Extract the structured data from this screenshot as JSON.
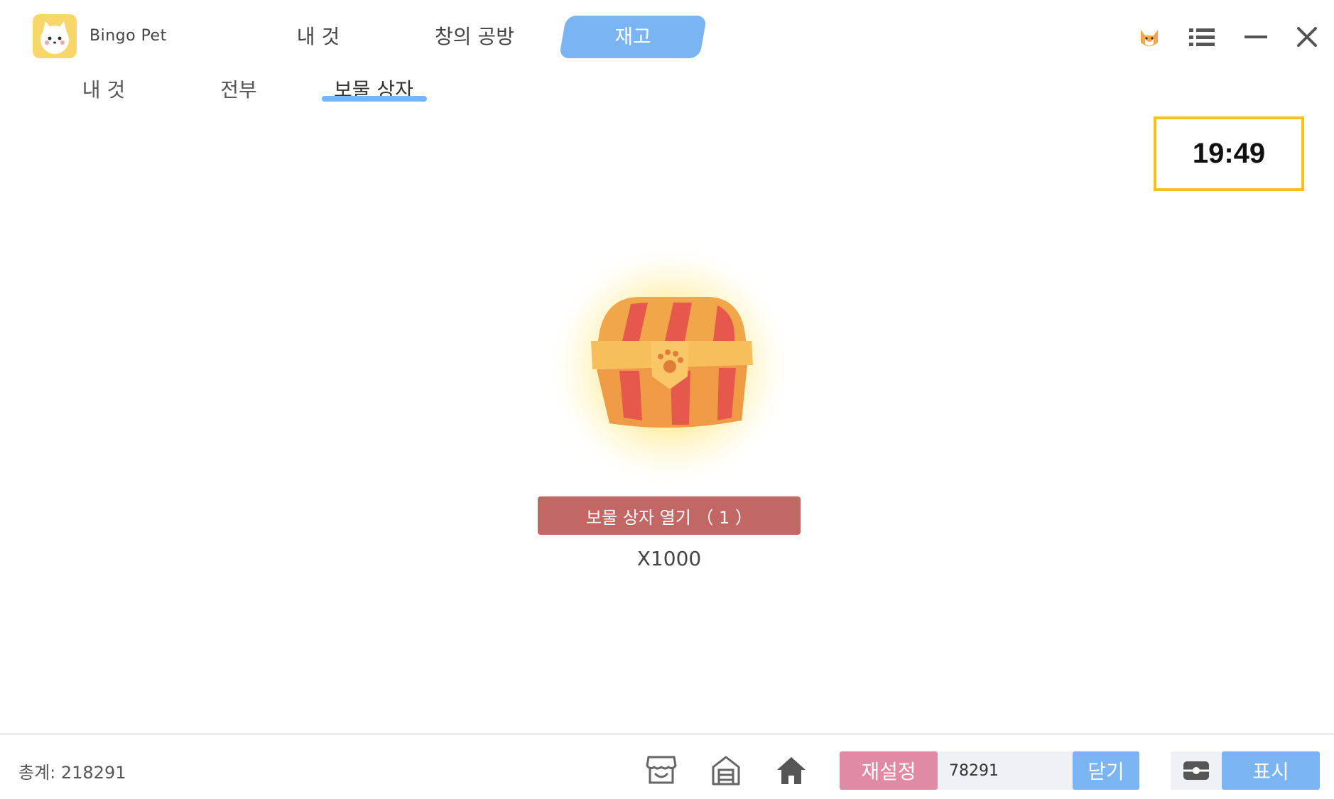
{
  "app": {
    "brand": "Bingo Pet"
  },
  "top_tabs": [
    {
      "label": "내 것",
      "active": false
    },
    {
      "label": "창의 공방",
      "active": false
    },
    {
      "label": "재고",
      "active": true
    }
  ],
  "sub_tabs": [
    {
      "label": "내 것",
      "active": false
    },
    {
      "label": "전부",
      "active": false
    },
    {
      "label": "보물 상자",
      "active": true
    }
  ],
  "clock": {
    "time": "19:49"
  },
  "chest": {
    "open_label": "보물 상자 열기 （ 1 ）",
    "quantity": "X1000"
  },
  "footer": {
    "total": "총계: 218291",
    "reset_label": "재설정",
    "code_value": "78291",
    "close_label": "닫기",
    "show_label": "표시"
  },
  "colors": {
    "accent_blue": "#7ab4f2",
    "open_button": "#c26763",
    "reset_pink": "#e08aa3",
    "clock_border": "#f6c21a"
  },
  "icons": [
    "pet-avatar-icon",
    "menu-icon",
    "minimize-icon",
    "close-icon",
    "shop-icon",
    "house-icon",
    "home-icon",
    "toggle-icon"
  ]
}
